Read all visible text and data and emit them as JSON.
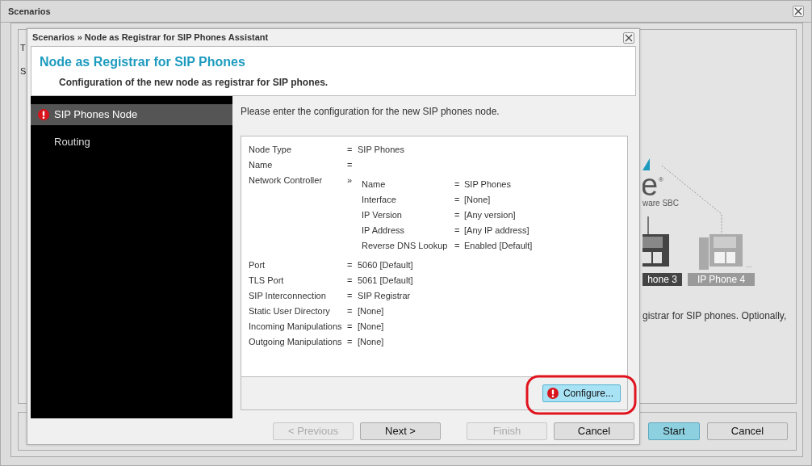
{
  "background_window": {
    "title": "Scenarios",
    "partial_texts": [
      "T",
      "S"
    ],
    "diagram": {
      "logo_text": "e",
      "logo_mark": "®",
      "logo_caption": "ware SBC",
      "more": "...",
      "phones": [
        {
          "label": "hone 3",
          "active": true
        },
        {
          "label": "IP Phone 4",
          "active": false
        }
      ]
    },
    "description": "gistrar for SIP phones. Optionally,",
    "buttons": [
      {
        "label": "Start",
        "primary": true
      },
      {
        "label": "Cancel",
        "primary": false
      }
    ]
  },
  "dialog": {
    "title": "Scenarios » Node as Registrar for SIP Phones Assistant",
    "heading": "Node as Registrar for SIP Phones",
    "subheading": "Configuration of the new node as registrar for SIP phones.",
    "steps": [
      {
        "label": "SIP Phones Node",
        "selected": true,
        "error": true
      },
      {
        "label": "Routing",
        "selected": false,
        "error": false
      }
    ],
    "intro": "Please enter the configuration for the new SIP phones node.",
    "settings": [
      {
        "label": "Node Type",
        "separator": "=",
        "value": "SIP Phones"
      },
      {
        "label": "Name",
        "separator": "="
      },
      {
        "label": "Network Controller",
        "separator": "»",
        "children": [
          {
            "label": "Name",
            "separator": "=",
            "value": "SIP Phones"
          },
          {
            "label": "Interface",
            "separator": "=",
            "value": "[None]"
          },
          {
            "label": "IP Version",
            "separator": "=",
            "value": "[Any version]"
          },
          {
            "label": "IP Address",
            "separator": "=",
            "value": "[Any IP address]"
          },
          {
            "label": "Reverse DNS Lookup",
            "separator": "=",
            "value": "Enabled [Default]"
          }
        ]
      },
      {
        "label": "Port",
        "separator": "=",
        "value": "5060 [Default]"
      },
      {
        "label": "TLS Port",
        "separator": "=",
        "value": "5061 [Default]"
      },
      {
        "label": "SIP Interconnection",
        "separator": "=",
        "value": "SIP Registrar"
      },
      {
        "label": "Static User Directory",
        "separator": "=",
        "value": "[None]"
      },
      {
        "label": "Incoming Manipulations",
        "separator": "=",
        "value": "[None]"
      },
      {
        "label": "Outgoing Manipulations",
        "separator": "=",
        "value": "[None]"
      }
    ],
    "configure_button": {
      "label": "Configure...",
      "error": true,
      "highlighted": true
    },
    "buttons": [
      {
        "label": "< Previous",
        "disabled": true
      },
      {
        "label": "Next >",
        "disabled": false
      },
      {
        "label": "Finish",
        "disabled": true
      },
      {
        "label": "Cancel",
        "disabled": false
      }
    ]
  }
}
